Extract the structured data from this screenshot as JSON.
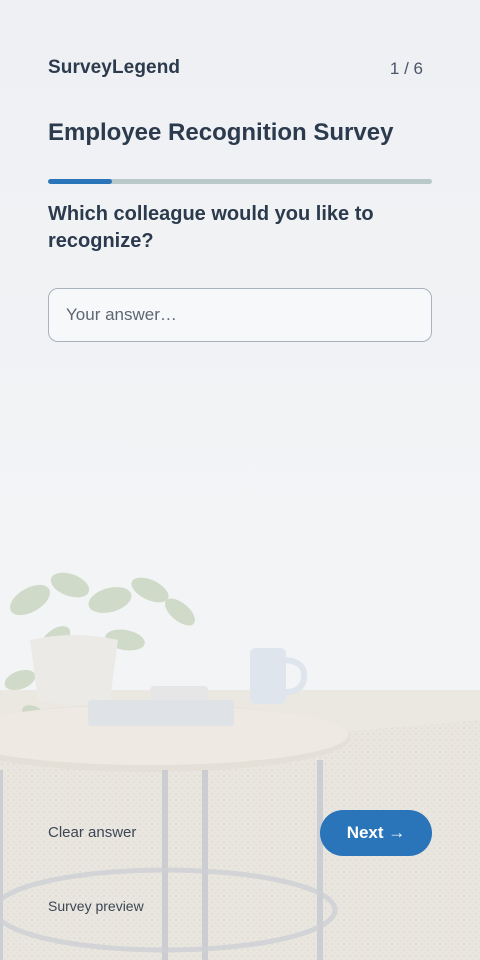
{
  "brand": {
    "name": "SurveyLegend"
  },
  "progress": {
    "counter": "1 / 6",
    "fraction": 0.167
  },
  "survey": {
    "title": "Employee Recognition Survey"
  },
  "question": {
    "text": "Which colleague would you like to recognize?",
    "answer_placeholder": "Your answer…",
    "answer_value": ""
  },
  "actions": {
    "clear_label": "Clear answer",
    "next_label": "Next →"
  },
  "footer": {
    "text": "Survey preview"
  },
  "colors": {
    "accent": "#2a74b9",
    "progress_track": "#b9c8c8",
    "text": "#2b3a4d"
  }
}
